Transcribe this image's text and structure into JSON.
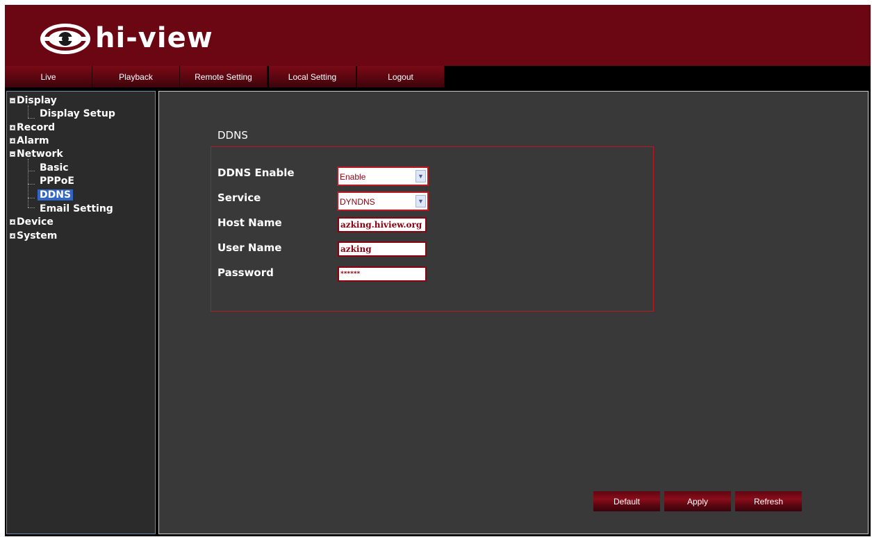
{
  "app": {
    "logo_text": "hi-view"
  },
  "nav": {
    "items": [
      {
        "label": "Live"
      },
      {
        "label": "Playback"
      },
      {
        "label": "Remote Setting"
      },
      {
        "label": "Local Setting"
      },
      {
        "label": "Logout"
      }
    ]
  },
  "tree": {
    "display": "Display",
    "display_setup": "Display Setup",
    "record": "Record",
    "alarm": "Alarm",
    "network": "Network",
    "basic": "Basic",
    "pppoe": "PPPoE",
    "ddns": "DDNS",
    "email_setting": "Email Setting",
    "device": "Device",
    "system": "System",
    "selected": "DDNS"
  },
  "form": {
    "title": "DDNS",
    "ddns_enable_label": "DDNS Enable",
    "ddns_enable_value": "Enable",
    "service_label": "Service",
    "service_value": "DYNDNS",
    "host_name_label": "Host Name",
    "host_name_value": "azking.hiview.org",
    "user_name_label": "User Name",
    "user_name_value": "azking",
    "password_label": "Password",
    "password_value": "******"
  },
  "buttons": {
    "default": "Default",
    "apply": "Apply",
    "refresh": "Refresh"
  },
  "colors": {
    "header_bg": "#6b0712",
    "accent_red": "#b81a24",
    "panel_bg": "#393939",
    "selected_bg": "#3166c5"
  }
}
